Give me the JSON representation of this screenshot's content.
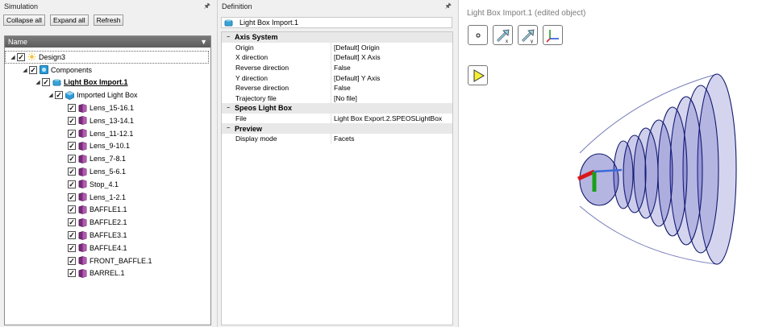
{
  "simulation": {
    "panel_title": "Simulation",
    "toolbar": {
      "collapse_label": "Collapse all",
      "expand_label": "Expand all",
      "refresh_label": "Refresh"
    },
    "tree_header": "Name",
    "tree": [
      {
        "label": "Design3",
        "level": 0,
        "expander": "◢",
        "icon": "design-sun-icon",
        "checked": true
      },
      {
        "label": "Components",
        "level": 1,
        "expander": "◢",
        "icon": "components-icon",
        "checked": true
      },
      {
        "label": "Light Box Import.1",
        "level": 2,
        "expander": "◢",
        "icon": "light-box-import-icon",
        "checked": true,
        "bold": true
      },
      {
        "label": "Imported Light Box",
        "level": 3,
        "expander": "◢",
        "icon": "imported-light-box-icon",
        "checked": true
      },
      {
        "label": "Lens_15-16.1",
        "level": 4,
        "icon": "body-icon",
        "checked": true
      },
      {
        "label": "Lens_13-14.1",
        "level": 4,
        "icon": "body-icon",
        "checked": true
      },
      {
        "label": "Lens_11-12.1",
        "level": 4,
        "icon": "body-icon",
        "checked": true
      },
      {
        "label": "Lens_9-10.1",
        "level": 4,
        "icon": "body-icon",
        "checked": true
      },
      {
        "label": "Lens_7-8.1",
        "level": 4,
        "icon": "body-icon",
        "checked": true
      },
      {
        "label": "Lens_5-6.1",
        "level": 4,
        "icon": "body-icon",
        "checked": true
      },
      {
        "label": "Stop_4.1",
        "level": 4,
        "icon": "body-icon",
        "checked": true
      },
      {
        "label": "Lens_1-2.1",
        "level": 4,
        "icon": "body-icon",
        "checked": true
      },
      {
        "label": "BAFFLE1.1",
        "level": 4,
        "icon": "body-icon",
        "checked": true
      },
      {
        "label": "BAFFLE2.1",
        "level": 4,
        "icon": "body-icon",
        "checked": true
      },
      {
        "label": "BAFFLE3.1",
        "level": 4,
        "icon": "body-icon",
        "checked": true
      },
      {
        "label": "BAFFLE4.1",
        "level": 4,
        "icon": "body-icon",
        "checked": true
      },
      {
        "label": "FRONT_BAFFLE.1",
        "level": 4,
        "icon": "body-icon",
        "checked": true
      },
      {
        "label": "BARREL.1",
        "level": 4,
        "icon": "body-icon",
        "checked": true
      }
    ]
  },
  "definition": {
    "panel_title": "Definition",
    "object_name": "Light Box Import.1",
    "categories": [
      {
        "name": "Axis System",
        "props": [
          {
            "name": "Origin",
            "value": "[Default] Origin"
          },
          {
            "name": "X direction",
            "value": "[Default] X Axis"
          },
          {
            "name": "Reverse direction",
            "value": "False"
          },
          {
            "name": "Y direction",
            "value": "[Default] Y Axis"
          },
          {
            "name": "Reverse direction",
            "value": "False"
          },
          {
            "name": "Trajectory file",
            "value": "[No file]"
          }
        ]
      },
      {
        "name": "Speos Light Box",
        "props": [
          {
            "name": "File",
            "value": "Light Box Export.2.SPEOSLightBox"
          }
        ]
      },
      {
        "name": "Preview",
        "props": [
          {
            "name": "Display mode",
            "value": "Facets"
          }
        ]
      }
    ]
  },
  "viewport": {
    "title": "Light Box Import.1 (edited object)",
    "tools": [
      "origin-point-icon",
      "x-direction-icon",
      "y-direction-icon",
      "axis-system-icon"
    ],
    "play_icon": "play-icon"
  },
  "colors": {
    "tree_header_bg": "#666666",
    "model_fill": "#2a2aa8",
    "play_fill": "#f5f032"
  }
}
